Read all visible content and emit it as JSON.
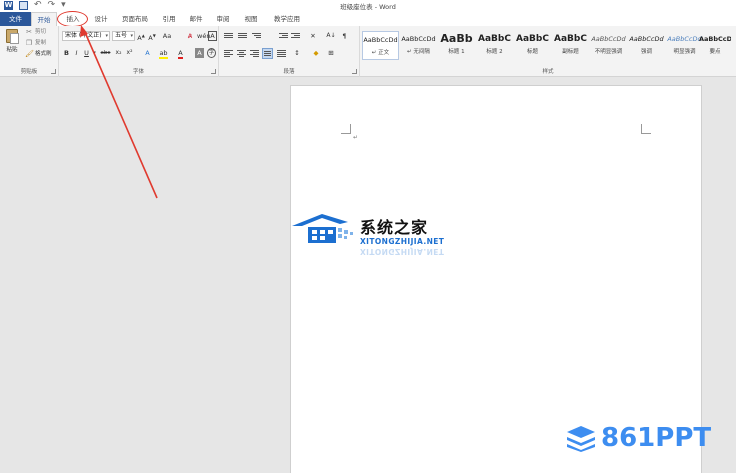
{
  "title_bar": {
    "document_title": "班级座位表 - Word",
    "app_icon": "W"
  },
  "tabs": [
    {
      "label": "文件"
    },
    {
      "label": "开始"
    },
    {
      "label": "插入"
    },
    {
      "label": "设计"
    },
    {
      "label": "页面布局"
    },
    {
      "label": "引用"
    },
    {
      "label": "邮件"
    },
    {
      "label": "审阅"
    },
    {
      "label": "视图"
    },
    {
      "label": "教学应用"
    }
  ],
  "ribbon": {
    "clipboard": {
      "paste": "粘贴",
      "cut": "剪切",
      "copy": "复制",
      "format_painter": "格式刷",
      "group_label": "剪贴板"
    },
    "font": {
      "font_name": "宋体 (中文正)",
      "font_size": "五号",
      "group_label": "字体",
      "aa": "Aa"
    },
    "paragraph": {
      "group_label": "段落"
    },
    "styles": {
      "group_label": "样式",
      "items": [
        {
          "sample": "AaBbCcDd",
          "name": "↵ 正文"
        },
        {
          "sample": "AaBbCcDd",
          "name": "↵ 无间隔"
        },
        {
          "sample": "AaBb",
          "name": "标题 1"
        },
        {
          "sample": "AaBbC",
          "name": "标题 2"
        },
        {
          "sample": "AaBbC",
          "name": "标题"
        },
        {
          "sample": "AaBbC",
          "name": "副标题"
        },
        {
          "sample": "AaBbCcDd",
          "name": "不明显强调"
        },
        {
          "sample": "AaBbCcDd",
          "name": "强调"
        },
        {
          "sample": "AaBbCcDd",
          "name": "明显强调"
        },
        {
          "sample": "AaBbCcDd",
          "name": "要点"
        }
      ]
    }
  },
  "document": {
    "paragraph_mark": "↵"
  },
  "watermarks": {
    "brand_cn": "系统之家",
    "brand_domain": "XITONGZHIJIA.NET",
    "ppt_brand": "861PPT"
  },
  "colors": {
    "word_blue": "#2b579a",
    "annotation_red": "#e03a2f",
    "watermark_blue": "#1c6fd0",
    "ppt_blue": "#3d8df0"
  }
}
